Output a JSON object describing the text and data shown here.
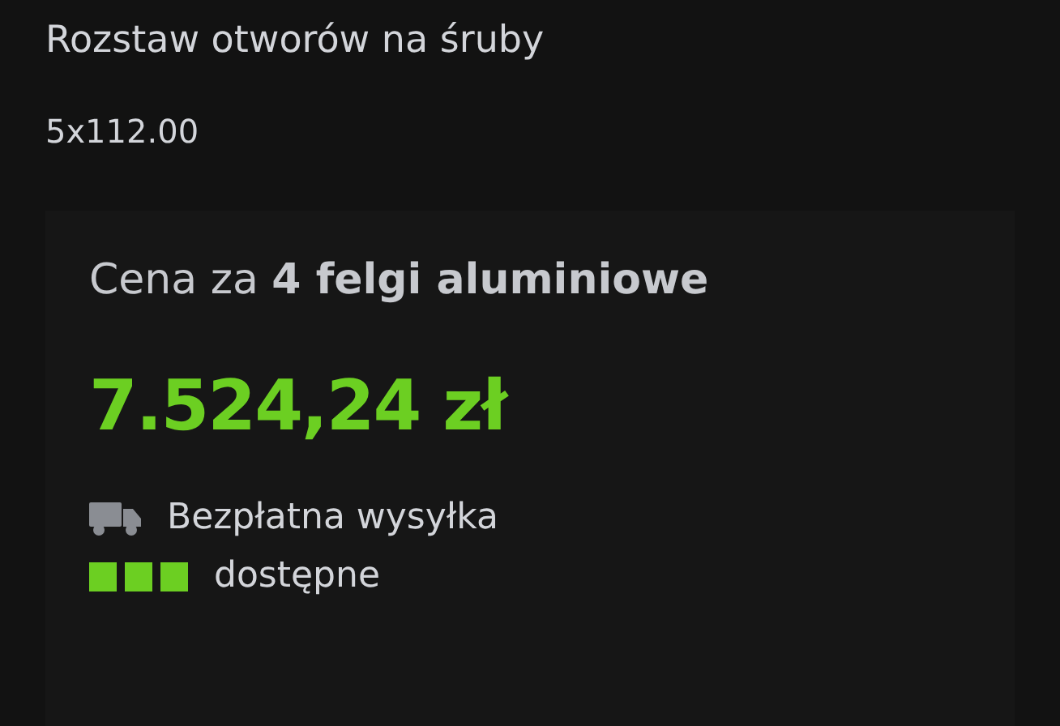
{
  "spec": {
    "label": "Rozstaw otworów na śruby",
    "value": "5x112.00"
  },
  "price_card": {
    "heading": "Cena za **4 felgi aluminiowe**",
    "price": "7.524,24 zł",
    "shipping": "Bezpłatna wysyłka",
    "availability": {
      "level": 1,
      "label": "dostępne"
    }
  }
}
